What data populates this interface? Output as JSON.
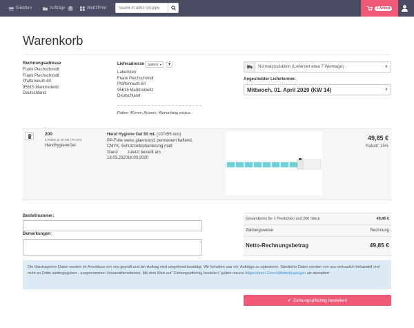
{
  "nav": {
    "items": [
      {
        "label": "Etiketten",
        "icon": "list-icon"
      },
      {
        "label": "Aufträge",
        "icon": "folder-icon",
        "badge": "0"
      },
      {
        "label": "Web2Print",
        "icon": "grid-icon"
      }
    ],
    "search_placeholder": "Suche in allen Gruppe",
    "cart_badge": "1 Artikel"
  },
  "page": {
    "title": "Warenkorb"
  },
  "billing": {
    "title": "Rechnungsadresse",
    "lines": [
      "Frank Plechschmidt",
      "Frank Plechschmidt",
      "Pfaffenreuth 60",
      "95615 Marktredwitz",
      "Deutschland"
    ]
  },
  "shipping": {
    "title": "Lieferadresse",
    "change_label": "ändern",
    "lines": [
      "Labelisten",
      "Frank Plechschmidt",
      "Pfaffenreuth 60",
      "95615 Marktredwitz",
      "Deutschland"
    ],
    "note": "Rollen: 40 mm, Aussen, Wortanfang voraus"
  },
  "delivery": {
    "production_option": "Normalproduktion (Lieferzeit etwa 7 Werktage)",
    "date_label": "Angestrebter Liefertermin:",
    "date_value": "Mittwoch, 01. April 2020 (KW 14)"
  },
  "product": {
    "qty": "200",
    "qty_detail": "5 Rollen je 40 Stk (70 mm)",
    "group": "HandhygieneGel",
    "name": "Hand Hygiene Gel 50 mL",
    "size": "(107x55 mm)",
    "material": "PP-Folie weiss glaenzend, permanent haftend,",
    "print": "CMYK, Schutzcellophanierung matt",
    "stand_label": "Stand",
    "stand_value": "zuletzt bestellt am",
    "dates": "18.03.202018.03.2020",
    "price": "49,85 €",
    "discount": "Rabatt: 15%"
  },
  "form": {
    "order_number_label": "Bestellnummer:",
    "remarks_label": "Bemerkungen:"
  },
  "summary": {
    "total_label": "Gesamtpreis für 1 Positionen und 200 Stück",
    "total_value": "49,85 €",
    "payment_label": "Zahlungsweise",
    "payment_value": "Rechnung",
    "net_label": "Netto-Rechnungsbetrag",
    "net_value": "49,85 €"
  },
  "info": {
    "text": "Die übertragenen Daten werden im Anschluss von uns geprüft und der Auftrag wird umgehend bestätigt. Wir behalten uns vor, Aufträge zu optimieren. Sämtliche Daten werden von uns vertraulich behandelt und nicht an Dritte weitergegeben - ausgenommen Versanddienstleister. Mit dem Klick auf \"Zahlungspflichtig bestellen\" gelten unsere",
    "link": "Allgemeinen Geschäftsbedingungen",
    "suffix": "als akzeptiert."
  },
  "order_button": "Zahlungspflichtig bestellen!",
  "colors": {
    "topbar": "#4a4c63",
    "accent": "#f05a78",
    "info_bg": "#dbeaf5",
    "link": "#3b8ed1"
  }
}
